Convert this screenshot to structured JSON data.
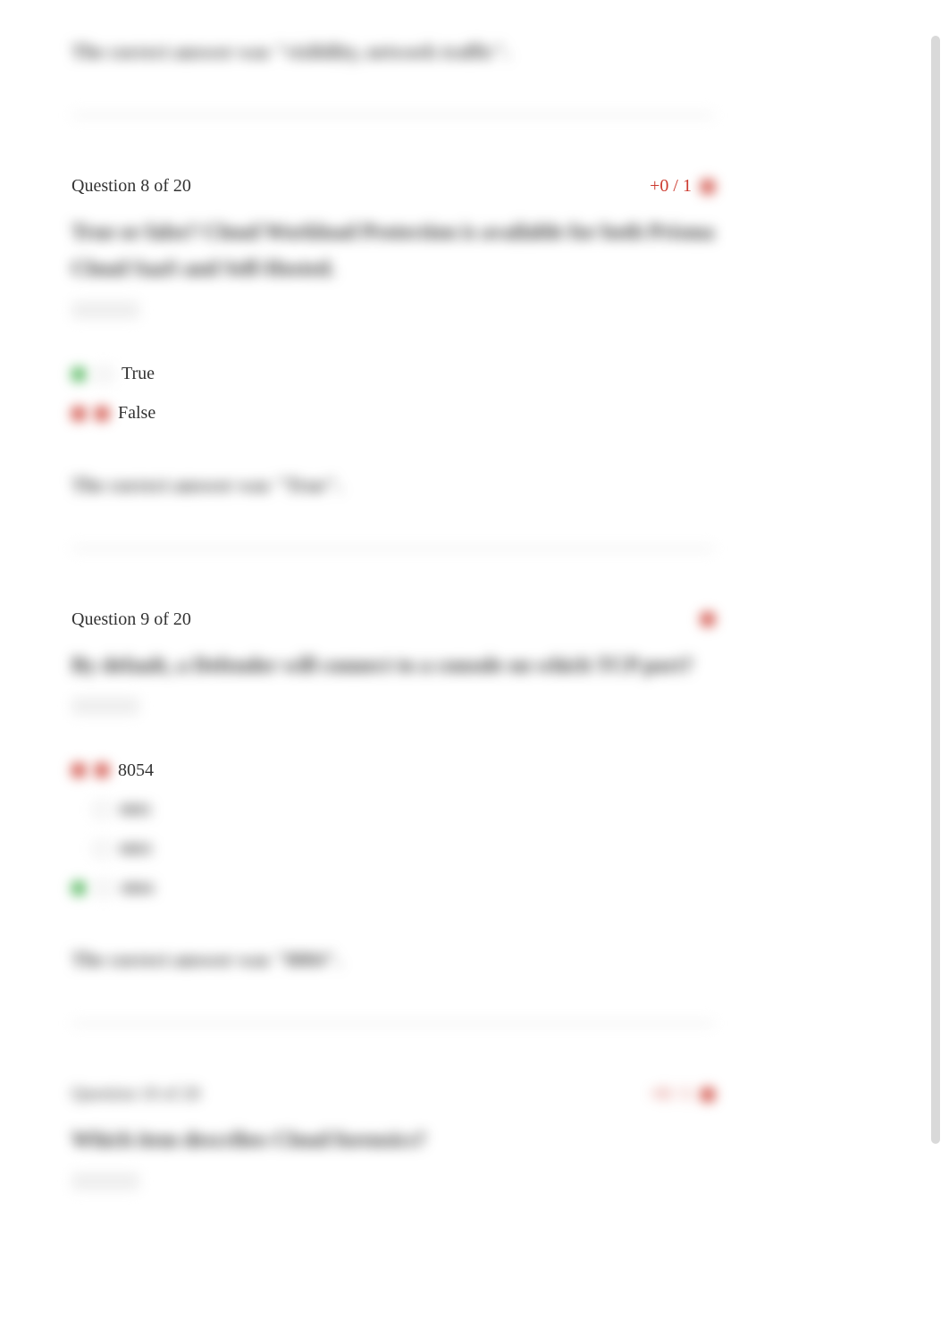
{
  "feedback7": "The correct answer was \"visibility, network traffic\".",
  "q8": {
    "header": "Question 8 of 20",
    "score": "+0 / 1",
    "prompt": "True or false? Cloud Workload Protection is available for both Prisma Cloud SaaS and Self-Hosted.",
    "options": {
      "true_label": "True",
      "false_label": "False"
    },
    "feedback": "The correct answer was \"True\"."
  },
  "q9": {
    "header": "Question 9 of 20",
    "prompt": "By default, a Defender will connect to a console on which TCP port?",
    "options": {
      "a": "8054",
      "b": "8081",
      "c": "8083",
      "d": "8084"
    },
    "feedback": "The correct answer was \"8084\"."
  },
  "q10": {
    "header": "Question 10 of 20",
    "score": "+0 / 1",
    "prompt": "Which item describes Cloud forensics?"
  }
}
